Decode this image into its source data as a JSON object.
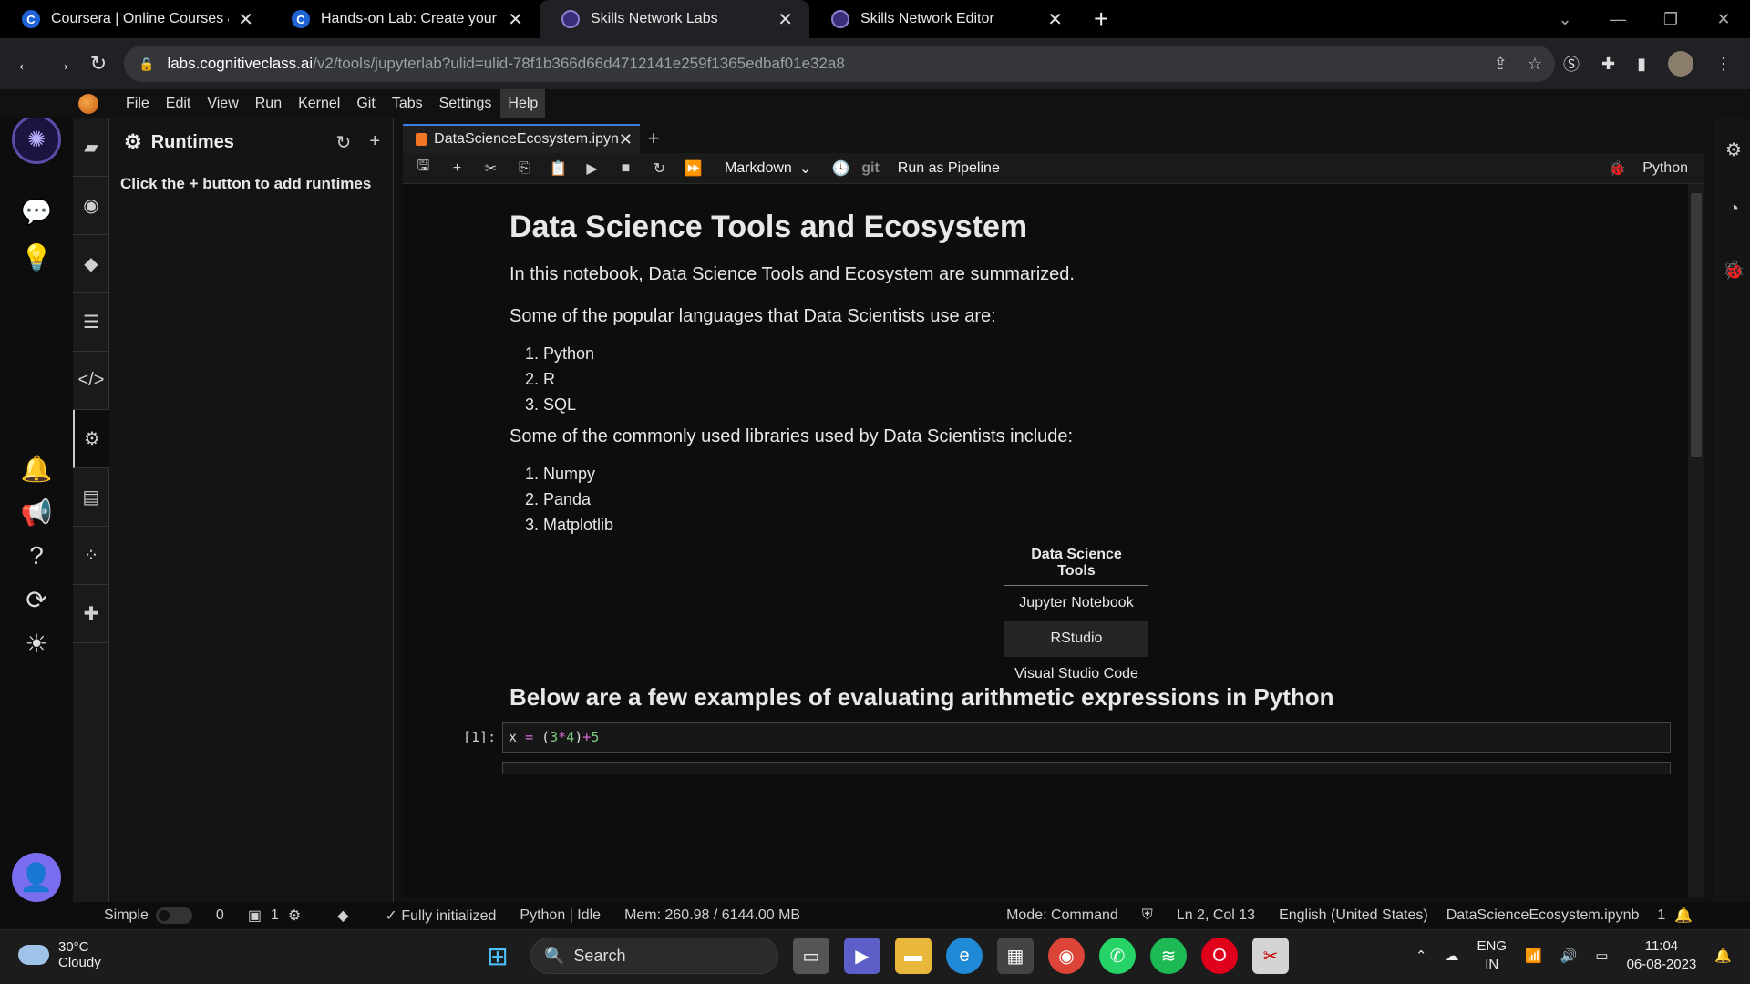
{
  "browser": {
    "tabs": [
      {
        "favicon": "C",
        "title": "Coursera | Online Courses & Cre",
        "active": false
      },
      {
        "favicon": "C",
        "title": "Hands-on Lab: Create your Jupyte",
        "active": false
      },
      {
        "favicon": "snl",
        "title": "Skills Network Labs",
        "active": true
      },
      {
        "favicon": "snl",
        "title": "Skills Network Editor",
        "active": false
      }
    ],
    "new_tab": "+",
    "address": {
      "host": "labs.cognitiveclass.ai",
      "path": "/v2/tools/jupyterlab?ulid=ulid-78f1b366d66d4712141e259f1365edbaf01e32a8"
    }
  },
  "menu": [
    "File",
    "Edit",
    "View",
    "Run",
    "Kernel",
    "Git",
    "Tabs",
    "Settings",
    "Help"
  ],
  "runtimes": {
    "title": "Runtimes",
    "message": "Click the + button to add runtimes"
  },
  "doc_tab": {
    "title": "DataScienceEcosystem.ipyn"
  },
  "toolbar": {
    "cell_type": "Markdown",
    "git": "git",
    "run_pipeline": "Run as Pipeline",
    "kernel": "Python"
  },
  "notebook": {
    "h1": "Data Science Tools and Ecosystem",
    "intro": "In this notebook, Data Science Tools and Ecosystem are summarized.",
    "languages_intro": "Some of the popular languages that Data Scientists use are:",
    "languages": [
      "1. Python",
      "2. R",
      "3. SQL"
    ],
    "libraries_intro": "Some of the commonly used libraries used by Data Scientists include:",
    "libraries": [
      "1. Numpy",
      "2. Panda",
      "3. Matplotlib"
    ],
    "tools_table": {
      "header": "Data Science Tools",
      "rows": [
        "Jupyter Notebook",
        "RStudio",
        "Visual Studio Code"
      ]
    },
    "h2": "Below are a few examples of evaluating arithmetic expressions in Python",
    "code_cell": {
      "prompt": "[1]:",
      "var": "x",
      "eq": "=",
      "lp": "(",
      "a": "3",
      "mul": "*",
      "b": "4",
      "rp": ")",
      "plus": "+",
      "c": "5"
    }
  },
  "status": {
    "mode_label": "Simple",
    "terminals": "0",
    "kernels": "1",
    "initialized": "Fully initialized",
    "kernel_state": "Python | Idle",
    "memory": "Mem: 260.98 / 6144.00 MB",
    "mode": "Mode: Command",
    "position": "Ln 2, Col 13",
    "language": "English (United States)",
    "filename": "DataScienceEcosystem.ipynb",
    "notifications": "1"
  },
  "taskbar": {
    "temperature": "30°C",
    "condition": "Cloudy",
    "search_placeholder": "Search",
    "lang_top": "ENG",
    "lang_bottom": "IN",
    "time": "11:04",
    "date": "06-08-2023"
  }
}
